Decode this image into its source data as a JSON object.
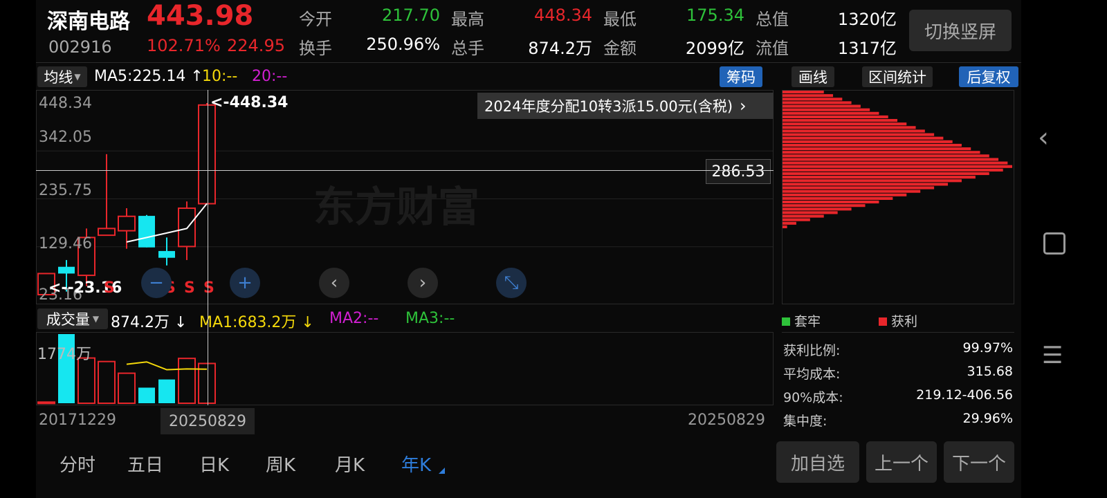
{
  "header": {
    "name": "深南电路",
    "price": "443.98",
    "code": "002916",
    "change_pct": "102.71%",
    "change_amt": "224.95",
    "stats": [
      {
        "label": "今开",
        "value": "217.70",
        "tone": "green"
      },
      {
        "label": "最高",
        "value": "448.34",
        "tone": "red"
      },
      {
        "label": "最低",
        "value": "175.34",
        "tone": "green"
      },
      {
        "label": "总值",
        "value": "1320亿",
        "tone": "white"
      },
      {
        "label": "换手",
        "value": "250.96%",
        "tone": "white"
      },
      {
        "label": "总手",
        "value": "874.2万",
        "tone": "white"
      },
      {
        "label": "金额",
        "value": "2099亿",
        "tone": "white"
      },
      {
        "label": "流值",
        "value": "1317亿",
        "tone": "white"
      }
    ],
    "switch_label": "切换竖屏"
  },
  "ma_bar": {
    "selector": "均线",
    "ma5": "MA5:225.14",
    "ma5_arrow": "↑",
    "ma10": "10:--",
    "ma20": "20:--"
  },
  "tools": {
    "chips": "筹码",
    "draw": "画线",
    "range_stats": "区间统计",
    "adjust": "后复权"
  },
  "main_chart": {
    "y_labels": [
      "448.34",
      "342.05",
      "235.75",
      "129.46",
      "23.16"
    ],
    "high_label": "<-448.34",
    "low_label": "<--23.16",
    "crosshair_price": "286.53",
    "notice": "2024年度分配10转3派15.00元(含税)",
    "notice_arrow": "›",
    "watermark": "东方财富",
    "s_label": "S",
    "candles": [
      {
        "o": 23.16,
        "c": 70,
        "h": 70,
        "l": 23.16,
        "up": true
      },
      {
        "o": 85,
        "c": 70,
        "h": 100,
        "l": 30,
        "up": false
      },
      {
        "o": 66,
        "c": 150,
        "h": 170,
        "l": 42,
        "up": true
      },
      {
        "o": 155,
        "c": 170,
        "h": 335,
        "l": 160,
        "up": true
      },
      {
        "o": 165,
        "c": 197,
        "h": 215,
        "l": 125,
        "up": true
      },
      {
        "o": 198,
        "c": 128,
        "h": 200,
        "l": 128,
        "up": false
      },
      {
        "o": 120,
        "c": 105,
        "h": 150,
        "l": 88,
        "up": false
      },
      {
        "o": 130,
        "c": 215,
        "h": 230,
        "l": 100,
        "up": true
      },
      {
        "o": 225,
        "c": 443.98,
        "h": 448.34,
        "l": 225,
        "up": true
      }
    ],
    "ma_line": [
      null,
      null,
      null,
      null,
      140,
      150,
      160,
      170,
      225.14
    ]
  },
  "controls": {
    "zoom_out": "−",
    "zoom_in": "+",
    "prev": "‹",
    "next": "›",
    "collapse": "⤡"
  },
  "volume": {
    "selector": "成交量",
    "value": "874.2万",
    "value_arrow": "↓",
    "ma1": "MA1:683.2万",
    "ma1_arrow": "↓",
    "ma2": "MA2:--",
    "ma3": "MA3:--",
    "top_label": "1774万",
    "bars": [
      {
        "v": 30,
        "up": true
      },
      {
        "v": 1774,
        "up": false
      },
      {
        "v": 1160,
        "up": true
      },
      {
        "v": 1070,
        "up": true
      },
      {
        "v": 770,
        "up": true
      },
      {
        "v": 400,
        "up": false
      },
      {
        "v": 610,
        "up": false
      },
      {
        "v": 1150,
        "up": true
      },
      {
        "v": 1020,
        "up": true
      }
    ],
    "ma_line": [
      null,
      null,
      null,
      null,
      1000,
      1060,
      860,
      880,
      874
    ]
  },
  "dates": {
    "start": "20171229",
    "cursor": "20250829",
    "end": "20250829"
  },
  "periods": [
    "分时",
    "五日",
    "日K",
    "周K",
    "月K",
    "年K"
  ],
  "active_period": "年K",
  "chip_panel": {
    "legend_loss": "套牢",
    "legend_profit": "获利",
    "stats": [
      {
        "label": "获利比例:",
        "value": "99.97%"
      },
      {
        "label": "平均成本:",
        "value": "315.68"
      },
      {
        "label": "90%成本:",
        "value": "219.12-406.56"
      },
      {
        "label": "集中度:",
        "value": "29.96%"
      }
    ],
    "distribution": [
      0.18,
      0.22,
      0.26,
      0.3,
      0.34,
      0.38,
      0.42,
      0.46,
      0.5,
      0.54,
      0.58,
      0.62,
      0.66,
      0.7,
      0.74,
      0.78,
      0.82,
      0.86,
      0.9,
      0.94,
      0.98,
      1.0,
      0.96,
      0.9,
      0.84,
      0.78,
      0.72,
      0.66,
      0.6,
      0.54,
      0.48,
      0.42,
      0.36,
      0.3,
      0.24,
      0.18,
      0.12,
      0.06,
      0.02
    ]
  },
  "actions": {
    "add": "加自选",
    "prev": "上一个",
    "next": "下一个"
  },
  "colors": {
    "up": "#e8262b",
    "down": "#16e6f0",
    "ma_white": "#ffffff",
    "ma_yellow": "#f5d90a",
    "accent_blue": "#2163b7"
  }
}
